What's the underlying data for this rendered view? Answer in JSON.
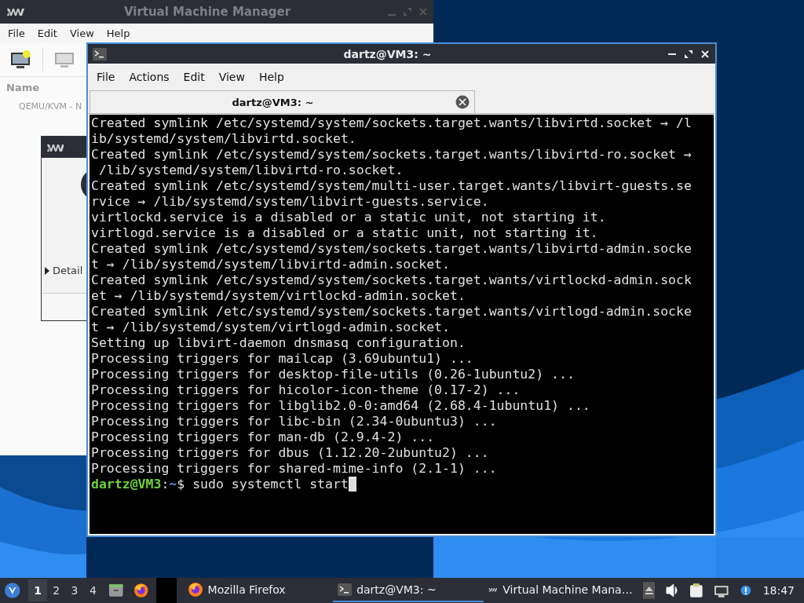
{
  "vmm_window": {
    "title": "Virtual Machine Manager",
    "menu": [
      "File",
      "Edit",
      "View",
      "Help"
    ],
    "column_header": "Name",
    "connection": "QEMU/KVM - N",
    "dialog": {
      "expander": "Detail"
    }
  },
  "terminal": {
    "title": "dartz@VM3: ~",
    "menu": [
      "File",
      "Actions",
      "Edit",
      "View",
      "Help"
    ],
    "tabs": [
      {
        "label": "dartz@VM3: ~",
        "selected": true
      }
    ],
    "lines": [
      "Created symlink /etc/systemd/system/sockets.target.wants/libvirtd.socket → /l",
      "ib/systemd/system/libvirtd.socket.",
      "Created symlink /etc/systemd/system/sockets.target.wants/libvirtd-ro.socket →",
      " /lib/systemd/system/libvirtd-ro.socket.",
      "Created symlink /etc/systemd/system/multi-user.target.wants/libvirt-guests.se",
      "rvice → /lib/systemd/system/libvirt-guests.service.",
      "virtlockd.service is a disabled or a static unit, not starting it.",
      "virtlogd.service is a disabled or a static unit, not starting it.",
      "Created symlink /etc/systemd/system/sockets.target.wants/libvirtd-admin.socke",
      "t → /lib/systemd/system/libvirtd-admin.socket.",
      "Created symlink /etc/systemd/system/sockets.target.wants/virtlockd-admin.sock",
      "et → /lib/systemd/system/virtlockd-admin.socket.",
      "Created symlink /etc/systemd/system/sockets.target.wants/virtlogd-admin.socke",
      "t → /lib/systemd/system/virtlogd-admin.socket.",
      "Setting up libvirt-daemon dnsmasq configuration.",
      "Processing triggers for mailcap (3.69ubuntu1) ...",
      "Processing triggers for desktop-file-utils (0.26-1ubuntu2) ...",
      "Processing triggers for hicolor-icon-theme (0.17-2) ...",
      "Processing triggers for libglib2.0-0:amd64 (2.68.4-1ubuntu1) ...",
      "Processing triggers for libc-bin (2.34-0ubuntu3) ...",
      "Processing triggers for man-db (2.9.4-2) ...",
      "Processing triggers for dbus (1.12.20-2ubuntu2) ...",
      "Processing triggers for shared-mime-info (2.1-1) ..."
    ],
    "prompt": {
      "user": "dartz@VM3",
      "separator": ":",
      "path": "~",
      "command": "$ sudo systemctl start"
    }
  },
  "taskbar": {
    "workspaces": [
      {
        "label": "1",
        "selected": true
      },
      {
        "label": "2",
        "selected": false
      },
      {
        "label": "3",
        "selected": false
      },
      {
        "label": "4",
        "selected": false
      }
    ],
    "tasks": [
      {
        "kind": "browser",
        "label": "Mozilla Firefox",
        "selected": false
      },
      {
        "kind": "terminal",
        "label": "dartz@VM3: ~",
        "selected": true
      },
      {
        "kind": "vmm",
        "label": "Virtual Machine Mana…",
        "selected": false
      }
    ],
    "clock": "18:47"
  }
}
